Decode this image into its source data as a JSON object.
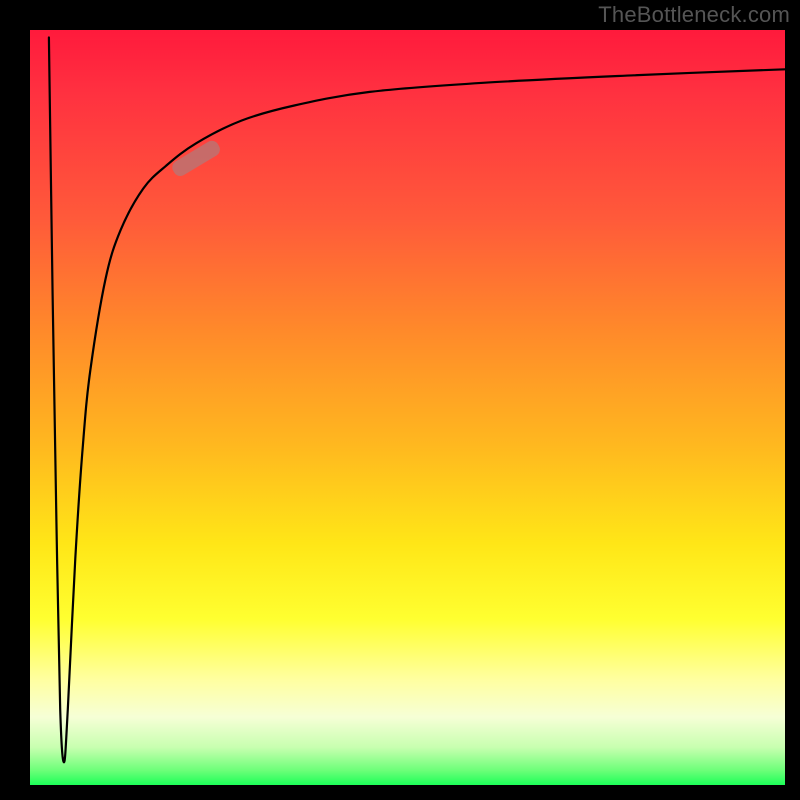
{
  "watermark": "TheBottleneck.com",
  "colors": {
    "frame": "#000000",
    "gradient_stops": [
      "#ff1a3c",
      "#ff5a3a",
      "#ff8a2a",
      "#ffe617",
      "#ffff30",
      "#c8ffb0",
      "#1dff58"
    ],
    "curve": "#000000",
    "marker": "rgba(180,120,120,0.75)"
  },
  "chart_data": {
    "type": "line",
    "title": "",
    "xlabel": "",
    "ylabel": "",
    "xlim": [
      0,
      100
    ],
    "ylim": [
      0,
      100
    ],
    "grid": false,
    "annotations": [
      {
        "name": "highlight-marker",
        "x": 22,
        "y": 83,
        "shape": "rounded-bar"
      }
    ],
    "series": [
      {
        "name": "bottleneck-curve",
        "x": [
          2.5,
          3.0,
          3.5,
          4.0,
          4.5,
          5.0,
          6.0,
          7.0,
          8.0,
          10.0,
          12.0,
          15.0,
          18.0,
          22.0,
          28.0,
          35.0,
          45.0,
          60.0,
          80.0,
          100.0
        ],
        "y": [
          99.0,
          65.0,
          35.0,
          10.0,
          3.0,
          10.0,
          30.0,
          45.0,
          55.0,
          67.0,
          73.5,
          79.0,
          82.0,
          85.0,
          88.0,
          90.0,
          91.8,
          93.0,
          94.0,
          94.8
        ]
      }
    ],
    "legend": false
  }
}
